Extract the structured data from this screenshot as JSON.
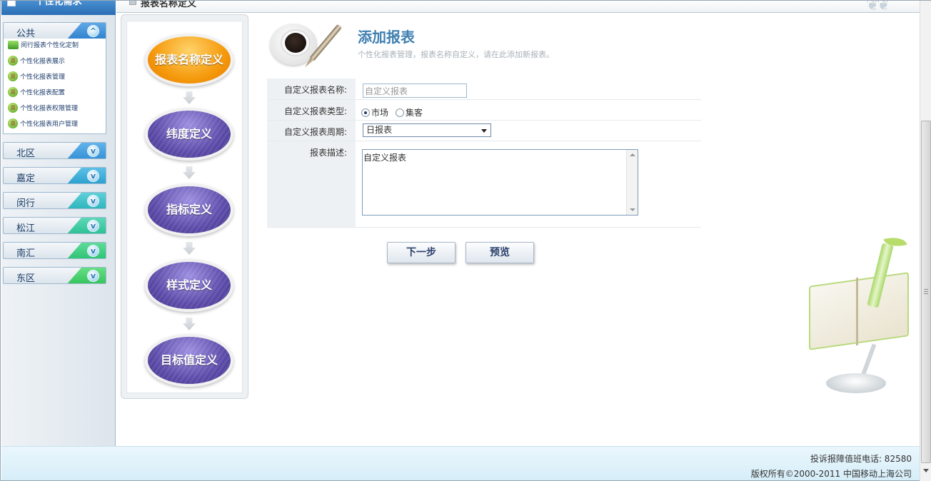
{
  "sidebar": {
    "header_title": "个性化需求",
    "groups": [
      {
        "label": "公共",
        "toggle": "^",
        "expanded": true
      },
      {
        "label": "北区",
        "toggle": "v"
      },
      {
        "label": "嘉定",
        "toggle": "v"
      },
      {
        "label": "闵行",
        "toggle": "v"
      },
      {
        "label": "松江",
        "toggle": "v"
      },
      {
        "label": "南汇",
        "toggle": "v"
      },
      {
        "label": "东区",
        "toggle": "v"
      }
    ],
    "public_items": [
      {
        "label": "闵行报表个性化定制",
        "icon": "flag-icon"
      },
      {
        "label": "个性化报表展示",
        "icon": "globe-icon"
      },
      {
        "label": "个性化报表管理",
        "icon": "globe-icon"
      },
      {
        "label": "个性化报表配置",
        "icon": "globe-icon"
      },
      {
        "label": "个性化报表权限管理",
        "icon": "globe-icon"
      },
      {
        "label": "个性化报表用户管理",
        "icon": "globe-icon"
      }
    ]
  },
  "breadcrumb": {
    "text": "报表名称定义"
  },
  "steps": [
    {
      "label": "报表名称定义",
      "active": true
    },
    {
      "label": "纬度定义",
      "active": false
    },
    {
      "label": "指标定义",
      "active": false
    },
    {
      "label": "样式定义",
      "active": false
    },
    {
      "label": "目标值定义",
      "active": false
    }
  ],
  "header": {
    "title": "添加报表",
    "subtitle": "个性化报表管理，报表名称自定义，请在此添加新报表。"
  },
  "form": {
    "name_label": "自定义报表名称:",
    "name_value": "自定义报表",
    "type_label": "自定义报表类型:",
    "type_options": [
      {
        "label": "市场",
        "checked": true
      },
      {
        "label": "集客",
        "checked": false
      }
    ],
    "period_label": "自定义报表周期:",
    "period_value": "日报表",
    "desc_label": "报表描述:",
    "desc_value": "自定义报表"
  },
  "buttons": {
    "next": "下一步",
    "preview": "预览"
  },
  "footer": {
    "hotline": "投诉报障值班电话: 82580",
    "copyright": "版权所有©2000-2011 中国移动上海公司"
  },
  "colors": {
    "accent": "#3f7fb0",
    "active_step": "#f59a0d",
    "inactive_step": "#5b4aa8"
  }
}
